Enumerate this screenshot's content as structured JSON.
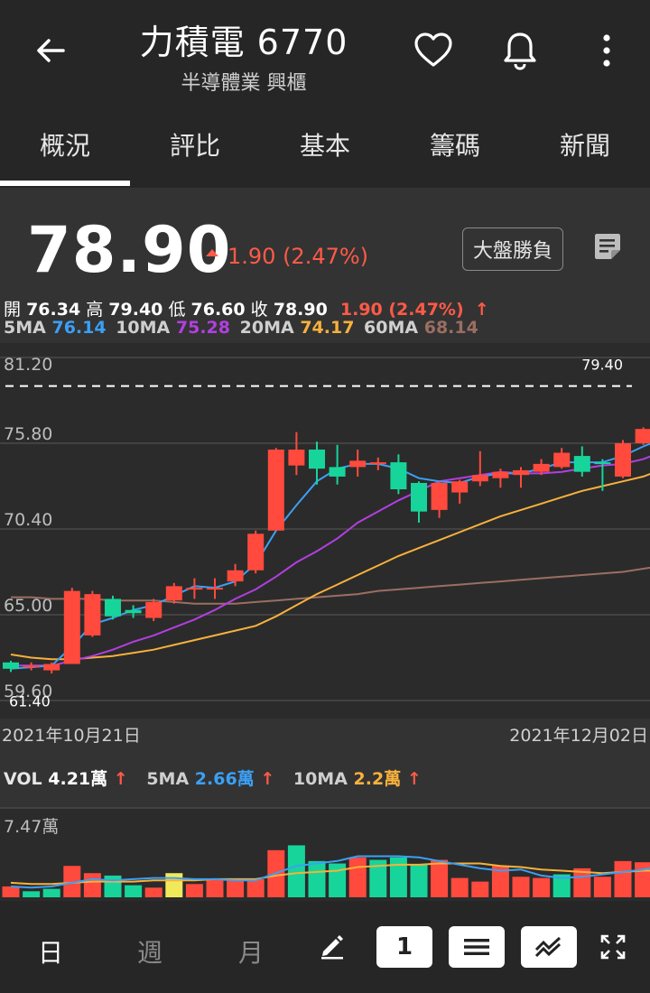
{
  "header": {
    "title": "力積電 6770",
    "subtitle": "半導體業 興櫃",
    "icons": [
      "back-arrow-icon",
      "heart-icon",
      "bell-icon",
      "more-vertical-icon"
    ]
  },
  "tabs": [
    "概況",
    "評比",
    "基本",
    "籌碼",
    "新聞"
  ],
  "active_tab": "概況",
  "quote": {
    "price": "78.90",
    "change": "1.90 (2.47%)",
    "dapan_button": "大盤勝負"
  },
  "ohlc": {
    "open_label": "開",
    "open": "76.34",
    "high_label": "高",
    "high": "79.40",
    "low_label": "低",
    "low": "76.60",
    "close_label": "收",
    "close": "78.90",
    "change": "1.90 (2.47%)",
    "arrow": "↑"
  },
  "ma": {
    "ma5_label": "5MA",
    "ma5": "76.14",
    "ma10_label": "10MA",
    "ma10": "75.28",
    "ma20_label": "20MA",
    "ma20": "74.17",
    "ma60_label": "60MA",
    "ma60": "68.14"
  },
  "dates": {
    "start": "2021年10月21日",
    "end": "2021年12月02日"
  },
  "volume": {
    "vol_label": "VOL",
    "vol": "4.21萬",
    "ma5_label": "5MA",
    "ma5": "2.66萬",
    "ma10_label": "10MA",
    "ma10": "2.2萬",
    "arrow": "↑",
    "max_label": "7.47萬"
  },
  "colors": {
    "up": "#ff4a3d",
    "down": "#17d59a",
    "flat": "#f0e95a",
    "ma5": "#3ba0f5",
    "ma10": "#b23fe0",
    "ma20": "#f7b13c",
    "ma60": "#9b6e62"
  },
  "toolbar": {
    "day": "日",
    "week": "週",
    "month": "月",
    "count": "1",
    "icons": [
      "pencil-icon",
      "menu-lines-icon",
      "trend-lines-icon",
      "fullscreen-icon"
    ]
  },
  "chart_data": {
    "type": "candlestick",
    "ylim": [
      59.6,
      81.2
    ],
    "y_ticks": [
      "81.20",
      "75.80",
      "70.40",
      "65.00",
      "59.60"
    ],
    "high_marker": "79.40",
    "low_marker": "61.40",
    "candles": [
      {
        "o": 62.0,
        "h": 62.1,
        "l": 61.4,
        "c": 61.6
      },
      {
        "o": 61.7,
        "h": 62.0,
        "l": 61.5,
        "c": 61.8
      },
      {
        "o": 61.5,
        "h": 62.0,
        "l": 61.3,
        "c": 61.9
      },
      {
        "o": 61.9,
        "h": 66.7,
        "l": 61.9,
        "c": 66.5
      },
      {
        "o": 63.7,
        "h": 66.5,
        "l": 63.6,
        "c": 66.3
      },
      {
        "o": 66.0,
        "h": 66.2,
        "l": 64.7,
        "c": 64.9
      },
      {
        "o": 65.3,
        "h": 65.6,
        "l": 64.8,
        "c": 65.1
      },
      {
        "o": 64.8,
        "h": 66.0,
        "l": 64.6,
        "c": 65.8
      },
      {
        "o": 65.9,
        "h": 67.0,
        "l": 65.7,
        "c": 66.8
      },
      {
        "o": 66.6,
        "h": 67.3,
        "l": 66.0,
        "c": 66.7
      },
      {
        "o": 66.6,
        "h": 67.3,
        "l": 66.0,
        "c": 66.7
      },
      {
        "o": 67.1,
        "h": 68.2,
        "l": 66.8,
        "c": 67.8
      },
      {
        "o": 67.8,
        "h": 70.3,
        "l": 67.6,
        "c": 70.1
      },
      {
        "o": 70.3,
        "h": 75.5,
        "l": 70.3,
        "c": 75.4
      },
      {
        "o": 74.4,
        "h": 76.5,
        "l": 73.8,
        "c": 75.4
      },
      {
        "o": 75.4,
        "h": 75.9,
        "l": 73.2,
        "c": 74.2
      },
      {
        "o": 74.3,
        "h": 75.7,
        "l": 73.2,
        "c": 73.7
      },
      {
        "o": 74.3,
        "h": 75.4,
        "l": 73.7,
        "c": 74.7
      },
      {
        "o": 74.5,
        "h": 74.9,
        "l": 74.1,
        "c": 74.6
      },
      {
        "o": 74.6,
        "h": 75.1,
        "l": 72.6,
        "c": 72.9
      },
      {
        "o": 73.3,
        "h": 73.4,
        "l": 70.8,
        "c": 71.5
      },
      {
        "o": 71.6,
        "h": 73.4,
        "l": 71.1,
        "c": 73.3
      },
      {
        "o": 72.7,
        "h": 73.5,
        "l": 72.0,
        "c": 73.4
      },
      {
        "o": 73.4,
        "h": 75.3,
        "l": 73.1,
        "c": 73.8
      },
      {
        "o": 73.6,
        "h": 74.2,
        "l": 73.0,
        "c": 74.0
      },
      {
        "o": 73.8,
        "h": 74.3,
        "l": 73.0,
        "c": 74.1
      },
      {
        "o": 74.0,
        "h": 74.8,
        "l": 73.8,
        "c": 74.5
      },
      {
        "o": 74.3,
        "h": 75.5,
        "l": 74.2,
        "c": 75.2
      },
      {
        "o": 75.0,
        "h": 75.6,
        "l": 73.7,
        "c": 74.0
      },
      {
        "o": 74.6,
        "h": 74.8,
        "l": 72.8,
        "c": 74.5
      },
      {
        "o": 73.7,
        "h": 76.0,
        "l": 73.6,
        "c": 75.8
      },
      {
        "o": 75.8,
        "h": 76.8,
        "l": 75.7,
        "c": 76.7
      },
      {
        "o": 77.0,
        "h": 79.4,
        "l": 76.6,
        "c": 78.9
      }
    ],
    "ma5": [
      61.6,
      61.7,
      61.8,
      63.0,
      64.4,
      64.8,
      65.3,
      65.6,
      66.2,
      66.8,
      66.7,
      67.1,
      68.2,
      70.3,
      71.9,
      73.4,
      74.2,
      74.5,
      74.5,
      74.2,
      73.6,
      73.4,
      73.3,
      73.7,
      73.9,
      73.9,
      74.2,
      74.6,
      74.6,
      74.6,
      75.0,
      75.6,
      76.1
    ],
    "ma10": [
      61.8,
      61.8,
      61.8,
      62.1,
      62.4,
      62.8,
      63.3,
      63.7,
      64.2,
      64.7,
      65.3,
      66.0,
      66.6,
      67.4,
      68.3,
      69.0,
      69.8,
      70.8,
      71.5,
      72.2,
      72.8,
      73.4,
      73.6,
      73.8,
      74.0,
      73.9,
      73.9,
      74.0,
      74.2,
      74.4,
      74.5,
      74.8,
      75.3
    ],
    "ma20": [
      62.5,
      62.3,
      62.2,
      62.2,
      62.3,
      62.4,
      62.6,
      62.8,
      63.1,
      63.4,
      63.7,
      64.0,
      64.3,
      64.9,
      65.6,
      66.3,
      66.9,
      67.5,
      68.1,
      68.7,
      69.2,
      69.7,
      70.2,
      70.7,
      71.2,
      71.6,
      72.0,
      72.4,
      72.8,
      73.1,
      73.4,
      73.7,
      74.2
    ],
    "ma60": [
      66.1,
      66.1,
      66.0,
      66.0,
      66.0,
      65.9,
      65.9,
      65.9,
      65.8,
      65.7,
      65.7,
      65.7,
      65.8,
      65.9,
      66.0,
      66.1,
      66.2,
      66.3,
      66.5,
      66.6,
      66.7,
      66.8,
      66.9,
      67.0,
      67.1,
      67.2,
      67.3,
      67.4,
      67.5,
      67.6,
      67.7,
      67.9,
      68.1
    ],
    "volume": {
      "max": 7.47,
      "values": [
        0.9,
        0.5,
        0.7,
        2.6,
        2.0,
        1.8,
        1.0,
        0.8,
        2.0,
        1.1,
        1.5,
        1.4,
        1.5,
        3.9,
        4.3,
        3.0,
        2.8,
        3.3,
        3.1,
        3.3,
        2.7,
        3.1,
        1.6,
        1.3,
        2.6,
        1.7,
        1.6,
        1.9,
        2.4,
        1.7,
        3.0,
        2.9,
        4.21
      ],
      "colors": [
        "up",
        "down",
        "down",
        "up",
        "up",
        "down",
        "down",
        "up",
        "flat",
        "up",
        "up",
        "up",
        "up",
        "up",
        "down",
        "down",
        "down",
        "up",
        "down",
        "down",
        "down",
        "up",
        "up",
        "up",
        "up",
        "up",
        "up",
        "down",
        "up",
        "up",
        "up",
        "up",
        "up"
      ],
      "ma5": [
        0.9,
        0.8,
        0.9,
        1.2,
        1.5,
        1.4,
        1.5,
        1.6,
        1.6,
        1.5,
        1.5,
        1.4,
        1.4,
        2.0,
        2.6,
        2.8,
        3.0,
        3.4,
        3.4,
        3.4,
        3.3,
        3.0,
        2.7,
        2.4,
        2.2,
        2.3,
        1.8,
        1.6,
        1.7,
        1.9,
        2.1,
        2.3,
        2.66
      ],
      "ma10": [
        1.2,
        1.1,
        1.1,
        1.2,
        1.3,
        1.3,
        1.3,
        1.4,
        1.4,
        1.4,
        1.5,
        1.5,
        1.5,
        1.8,
        2.0,
        2.1,
        2.2,
        2.5,
        2.6,
        2.7,
        2.7,
        2.8,
        2.8,
        2.8,
        2.6,
        2.5,
        2.3,
        2.2,
        2.1,
        2.0,
        2.1,
        2.2,
        2.2
      ]
    }
  }
}
